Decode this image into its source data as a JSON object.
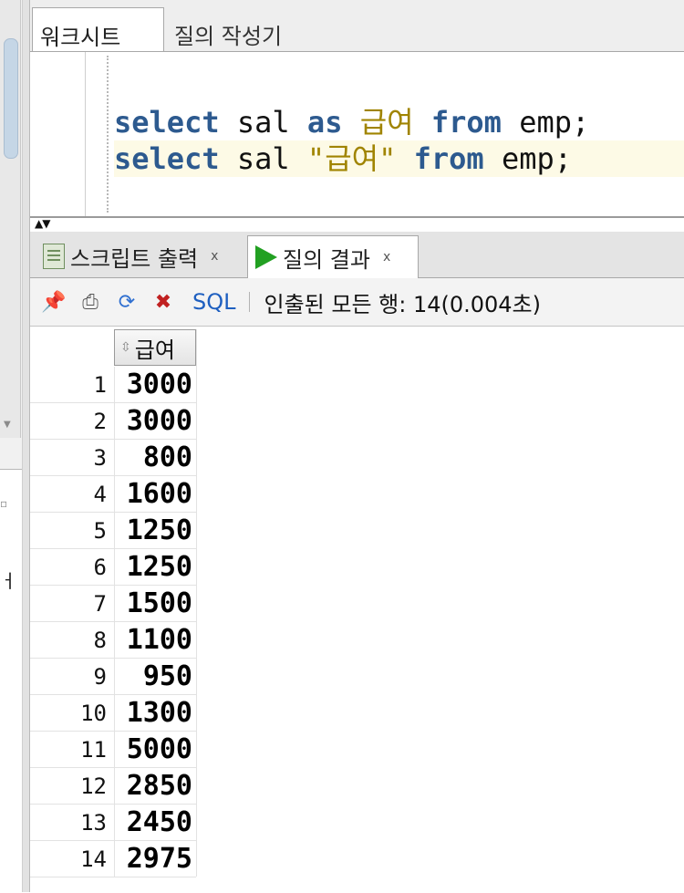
{
  "worksheet_tabs": [
    {
      "label": "워크시트",
      "active": true
    },
    {
      "label": "질의 작성기",
      "active": false
    }
  ],
  "editor": {
    "lines": [
      {
        "kw1": "select",
        "col": "sal",
        "kw2": "as",
        "alias": "급여",
        "kw3": "from",
        "tbl": "emp;"
      },
      {
        "kw1": "select",
        "col": "sal",
        "alias": "\"급여\"",
        "kw3": "from",
        "tbl": "emp;"
      }
    ]
  },
  "result_tabs": [
    {
      "label": "스크립트 출력",
      "icon": "script-output-icon",
      "active": false
    },
    {
      "label": "질의 결과",
      "icon": "run-icon",
      "active": true
    }
  ],
  "toolbar": {
    "sql_label": "SQL",
    "status": "인출된 모든 행: 14(0.004초)"
  },
  "grid": {
    "column": "급여",
    "rows": [
      {
        "n": "1",
        "v": "3000"
      },
      {
        "n": "2",
        "v": "3000"
      },
      {
        "n": "3",
        "v": "800"
      },
      {
        "n": "4",
        "v": "1600"
      },
      {
        "n": "5",
        "v": "1250"
      },
      {
        "n": "6",
        "v": "1250"
      },
      {
        "n": "7",
        "v": "1500"
      },
      {
        "n": "8",
        "v": "1100"
      },
      {
        "n": "9",
        "v": "950"
      },
      {
        "n": "10",
        "v": "1300"
      },
      {
        "n": "11",
        "v": "5000"
      },
      {
        "n": "12",
        "v": "2850"
      },
      {
        "n": "13",
        "v": "2450"
      },
      {
        "n": "14",
        "v": "2975"
      }
    ]
  },
  "left_panel": {
    "glyph": "ㅓ"
  },
  "colors": {
    "keyword": "#2d5a8f",
    "string": "#a08400",
    "run_green": "#22a022"
  }
}
